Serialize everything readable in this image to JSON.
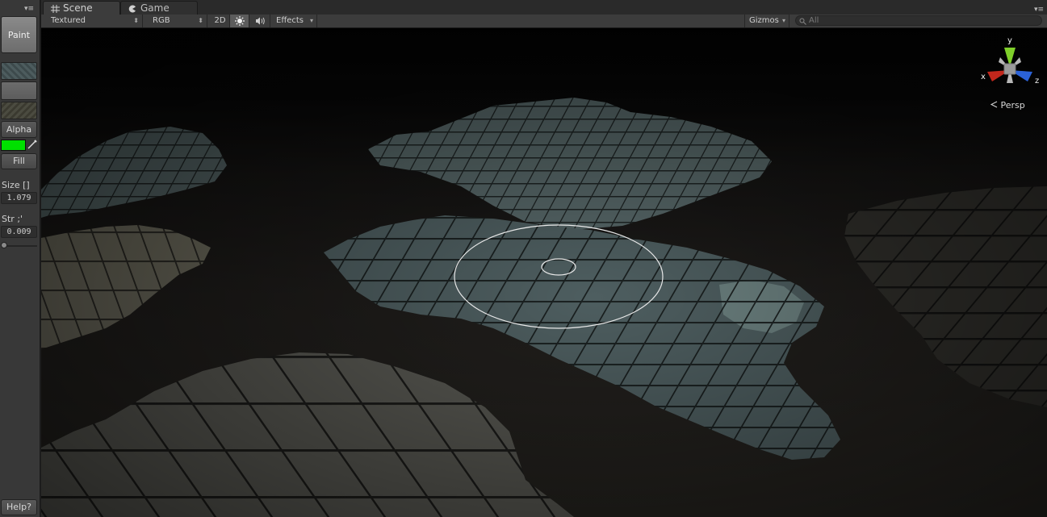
{
  "left_panel": {
    "menu_glyph": "▾≡",
    "paint_label": "Paint",
    "alpha_label": "Alpha",
    "paint_color": "#00e000",
    "fill_label": "Fill",
    "size_label": "Size []",
    "size_value": "1.079",
    "strength_label": "Str ;'",
    "strength_value": "0.009",
    "help_label": "Help?"
  },
  "tabs": [
    {
      "label": "Scene",
      "icon": "grid-icon",
      "active": true
    },
    {
      "label": "Game",
      "icon": "pacman-icon",
      "active": false
    }
  ],
  "tabbar_menu_glyph": "▾≡",
  "toolbar": {
    "shading_mode": "Textured",
    "render_mode": "RGB",
    "mode_2d": "2D",
    "lighting_icon": "sun-icon",
    "audio_icon": "speaker-icon",
    "effects_label": "Effects",
    "gizmos_label": "Gizmos",
    "search_placeholder": "All",
    "dropdown_arrow": "▾",
    "spinner_arrow": "⬍"
  },
  "scene_gizmo": {
    "x_label": "x",
    "y_label": "y",
    "z_label": "z",
    "x_color": "#c1271c",
    "y_color": "#7fcf2a",
    "z_color": "#2b62d8",
    "projection": "Persp",
    "projection_icon": "persp-chevron-icon"
  },
  "brush_color": "#e8e8e8"
}
